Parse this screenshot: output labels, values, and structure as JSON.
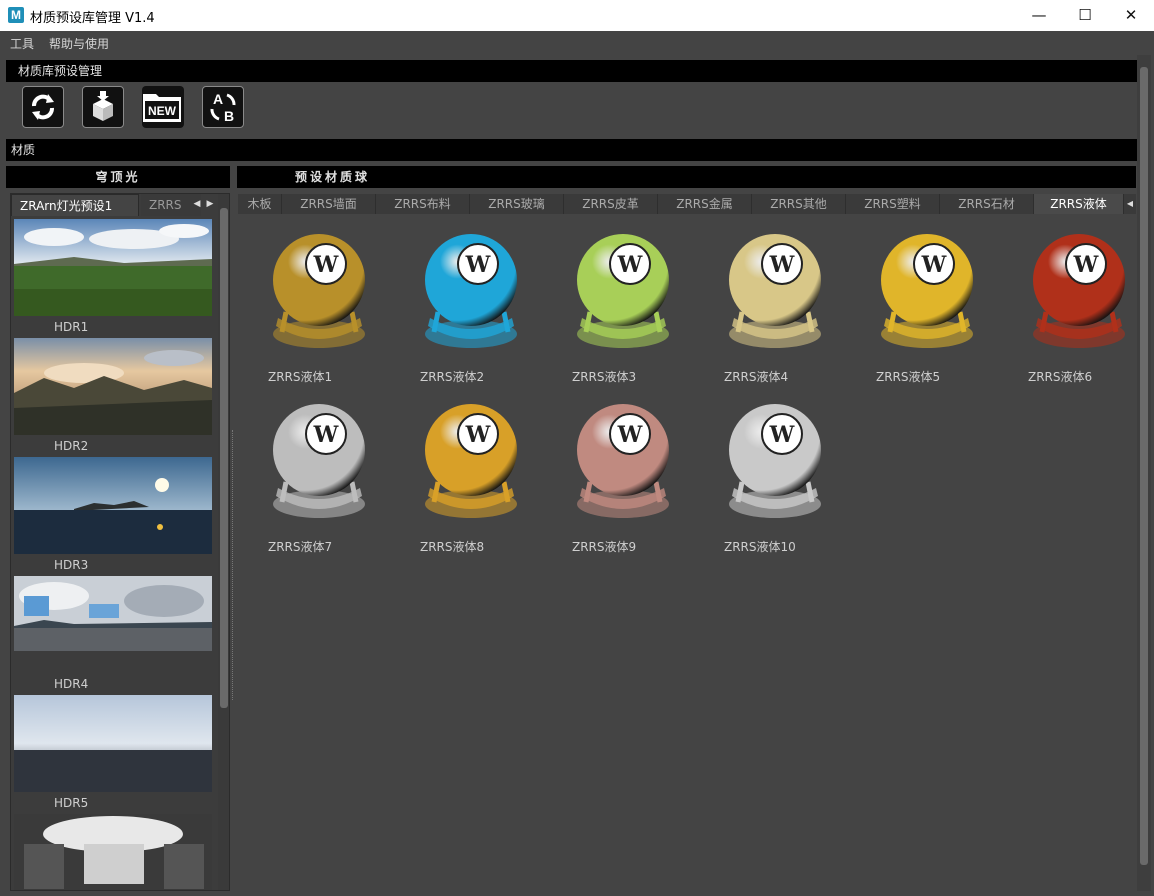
{
  "window": {
    "title": "材质预设库管理 V1.4",
    "icon_letter": "M",
    "minimize": "—",
    "maximize": "☐",
    "close": "✕"
  },
  "menu": {
    "items": [
      "工具",
      "帮助与使用"
    ]
  },
  "preset_manager": {
    "header": "材质库预设管理"
  },
  "toolbar": {
    "icons": [
      "refresh-icon",
      "package-icon",
      "new-folder-icon",
      "a-to-b-convert-icon"
    ],
    "new_label": "NEW"
  },
  "material_section": {
    "header": "材质"
  },
  "skylight": {
    "header": "穹顶光",
    "tabs": [
      "ZRArn灯光预设1",
      "ZRRS"
    ],
    "items": [
      {
        "label": "HDR1"
      },
      {
        "label": "HDR2"
      },
      {
        "label": "HDR3"
      },
      {
        "label": "HDR4"
      },
      {
        "label": "HDR5"
      },
      {
        "label": ""
      }
    ]
  },
  "materials": {
    "header": "预设材质球",
    "tabs": [
      "木板",
      "ZRRS墙面",
      "ZRRS布料",
      "ZRRS玻璃",
      "ZRRS皮革",
      "ZRRS金属",
      "ZRRS其他",
      "ZRRS塑料",
      "ZRRS石材",
      "ZRRS液体"
    ],
    "active_tab": "ZRRS液体",
    "items": [
      {
        "label": "ZRRS液体1",
        "color": "#b8902a"
      },
      {
        "label": "ZRRS液体2",
        "color": "#1fa6d8"
      },
      {
        "label": "ZRRS液体3",
        "color": "#a8cf58"
      },
      {
        "label": "ZRRS液体4",
        "color": "#d8c788"
      },
      {
        "label": "ZRRS液体5",
        "color": "#e0b52a"
      },
      {
        "label": "ZRRS液体6",
        "color": "#b0301a"
      },
      {
        "label": "ZRRS液体7",
        "color": "#bdbdbd"
      },
      {
        "label": "ZRRS液体8",
        "color": "#d8a028"
      },
      {
        "label": "ZRRS液体9",
        "color": "#c08a80"
      },
      {
        "label": "ZRRS液体10",
        "color": "#c9c9c9"
      }
    ]
  }
}
